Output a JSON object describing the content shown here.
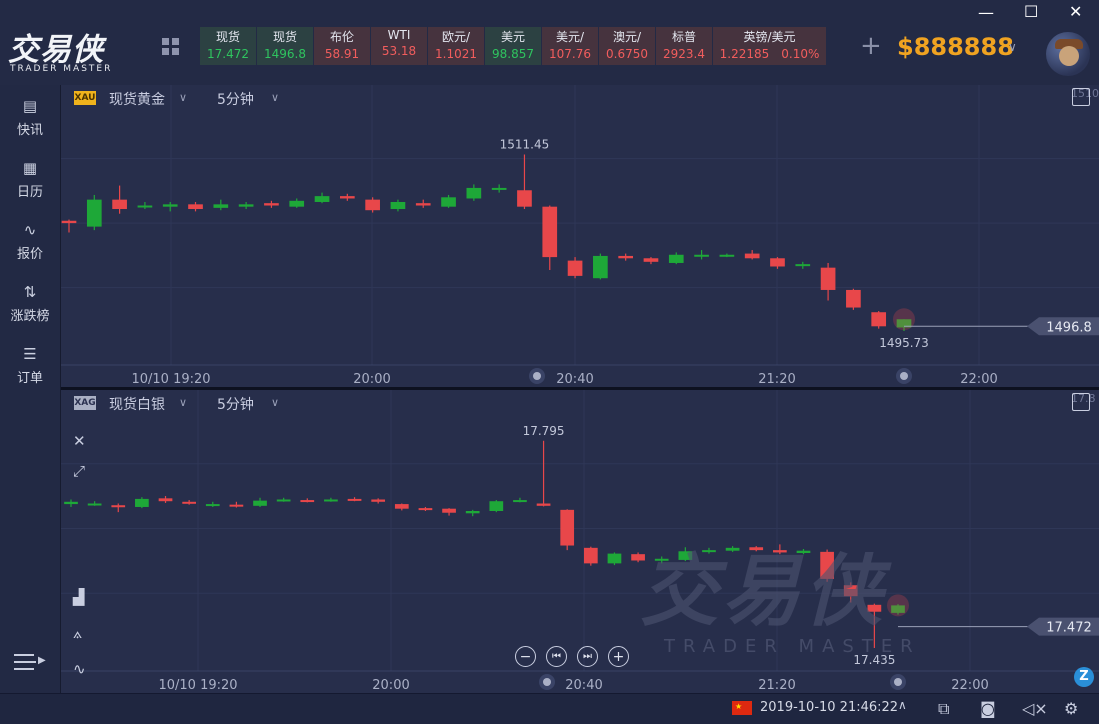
{
  "header": {
    "logo_cn": "交易侠",
    "logo_en": "TRADER MASTER",
    "balance": "$888888",
    "tickers": [
      {
        "name": "现货",
        "value": "17.472",
        "trend": "up"
      },
      {
        "name": "现货",
        "value": "1496.8",
        "trend": "up"
      },
      {
        "name": "布伦",
        "value": "58.91",
        "trend": "down"
      },
      {
        "name": "WTI",
        "value": "53.18",
        "trend": "down"
      },
      {
        "name": "欧元/",
        "value": "1.1021",
        "trend": "down"
      },
      {
        "name": "美元",
        "value": "98.857",
        "trend": "up"
      },
      {
        "name": "美元/",
        "value": "107.76",
        "trend": "down"
      },
      {
        "name": "澳元/",
        "value": "0.6750",
        "trend": "down"
      },
      {
        "name": "标普",
        "value": "2923.4",
        "trend": "down"
      },
      {
        "name": "英镑/美元",
        "value": "1.22185",
        "extra": "0.10%",
        "trend": "down"
      }
    ]
  },
  "sidebar": {
    "items": [
      {
        "label": "快讯",
        "icon": "newspaper-icon"
      },
      {
        "label": "日历",
        "icon": "calendar-icon"
      },
      {
        "label": "报价",
        "icon": "trend-line-icon"
      },
      {
        "label": "涨跌榜",
        "icon": "up-down-arrows-icon"
      },
      {
        "label": "订单",
        "icon": "order-list-icon"
      }
    ]
  },
  "charts": {
    "top": {
      "tag": "XAU",
      "name": "现货黄金",
      "period": "5分钟",
      "corner_label": "1510",
      "last_price": "1496.8"
    },
    "bottom": {
      "tag": "XAG",
      "name": "现货白银",
      "period": "5分钟",
      "corner_label": "17.8",
      "last_price": "17.472"
    }
  },
  "status": {
    "datetime": "2019-10-10 21:46:22"
  },
  "watermark": {
    "cn": "交易侠",
    "en": "TRADER MASTER"
  },
  "chart_data": [
    {
      "type": "candlestick",
      "title": "现货黄金",
      "period": "5分钟",
      "x_ticks": [
        "10/10 19:20",
        "20:00",
        "20:40",
        "21:20",
        "22:00"
      ],
      "high_label": "1511.45",
      "low_label": "1495.73",
      "last": "1496.8",
      "ylim": [
        1493.5,
        1515.5
      ],
      "candles": [
        {
          "o": 1505.8,
          "c": 1505.6,
          "h": 1505.9,
          "l": 1504.8
        },
        {
          "o": 1505.3,
          "c": 1507.6,
          "h": 1508.0,
          "l": 1505.0
        },
        {
          "o": 1507.6,
          "c": 1506.8,
          "h": 1508.8,
          "l": 1506.4
        },
        {
          "o": 1507.0,
          "c": 1507.1,
          "h": 1507.4,
          "l": 1506.8
        },
        {
          "o": 1507.0,
          "c": 1507.2,
          "h": 1507.4,
          "l": 1506.6
        },
        {
          "o": 1507.2,
          "c": 1506.8,
          "h": 1507.4,
          "l": 1506.6
        },
        {
          "o": 1506.9,
          "c": 1507.2,
          "h": 1507.6,
          "l": 1506.7
        },
        {
          "o": 1507.0,
          "c": 1507.2,
          "h": 1507.4,
          "l": 1506.8
        },
        {
          "o": 1507.3,
          "c": 1507.1,
          "h": 1507.5,
          "l": 1506.9
        },
        {
          "o": 1507.0,
          "c": 1507.5,
          "h": 1507.7,
          "l": 1506.9
        },
        {
          "o": 1507.4,
          "c": 1507.9,
          "h": 1508.2,
          "l": 1507.3
        },
        {
          "o": 1507.9,
          "c": 1507.7,
          "h": 1508.1,
          "l": 1507.5
        },
        {
          "o": 1507.6,
          "c": 1506.7,
          "h": 1507.8,
          "l": 1506.5
        },
        {
          "o": 1506.8,
          "c": 1507.4,
          "h": 1507.6,
          "l": 1506.6
        },
        {
          "o": 1507.3,
          "c": 1507.1,
          "h": 1507.6,
          "l": 1506.9
        },
        {
          "o": 1507.0,
          "c": 1507.8,
          "h": 1508.0,
          "l": 1506.9
        },
        {
          "o": 1507.7,
          "c": 1508.6,
          "h": 1508.9,
          "l": 1507.5
        },
        {
          "o": 1508.5,
          "c": 1508.6,
          "h": 1508.9,
          "l": 1508.2
        },
        {
          "o": 1508.4,
          "c": 1507.0,
          "h": 1511.45,
          "l": 1506.8
        },
        {
          "o": 1507.0,
          "c": 1502.7,
          "h": 1507.1,
          "l": 1501.6
        },
        {
          "o": 1502.4,
          "c": 1501.1,
          "h": 1502.7,
          "l": 1500.9
        },
        {
          "o": 1500.9,
          "c": 1502.8,
          "h": 1503.0,
          "l": 1500.8
        },
        {
          "o": 1502.8,
          "c": 1502.6,
          "h": 1503.0,
          "l": 1502.4
        },
        {
          "o": 1502.6,
          "c": 1502.3,
          "h": 1502.7,
          "l": 1502.1
        },
        {
          "o": 1502.2,
          "c": 1502.9,
          "h": 1503.1,
          "l": 1502.1
        },
        {
          "o": 1502.8,
          "c": 1502.9,
          "h": 1503.3,
          "l": 1502.5
        },
        {
          "o": 1502.9,
          "c": 1502.9,
          "h": 1503.0,
          "l": 1502.7
        },
        {
          "o": 1503.0,
          "c": 1502.6,
          "h": 1503.3,
          "l": 1502.5
        },
        {
          "o": 1502.6,
          "c": 1501.9,
          "h": 1502.7,
          "l": 1501.7
        },
        {
          "o": 1502.0,
          "c": 1502.1,
          "h": 1502.3,
          "l": 1501.7
        },
        {
          "o": 1501.8,
          "c": 1499.9,
          "h": 1502.2,
          "l": 1499.0
        },
        {
          "o": 1499.9,
          "c": 1498.4,
          "h": 1500.0,
          "l": 1498.2
        },
        {
          "o": 1498.0,
          "c": 1496.8,
          "h": 1498.1,
          "l": 1496.6
        },
        {
          "o": 1496.7,
          "c": 1497.4,
          "h": 1497.4,
          "l": 1496.4
        }
      ]
    },
    {
      "type": "candlestick",
      "title": "现货白银",
      "period": "5分钟",
      "x_ticks": [
        "10/10 19:20",
        "20:00",
        "20:40",
        "21:20",
        "22:00"
      ],
      "high_label": "17.795",
      "low_label": "17.435",
      "last": "17.472",
      "ylim": [
        17.395,
        17.845
      ],
      "candles": [
        {
          "o": 17.685,
          "c": 17.689,
          "h": 17.693,
          "l": 17.68
        },
        {
          "o": 17.686,
          "c": 17.686,
          "h": 17.69,
          "l": 17.682
        },
        {
          "o": 17.683,
          "c": 17.68,
          "h": 17.686,
          "l": 17.671
        },
        {
          "o": 17.68,
          "c": 17.694,
          "h": 17.697,
          "l": 17.678
        },
        {
          "o": 17.695,
          "c": 17.69,
          "h": 17.699,
          "l": 17.687
        },
        {
          "o": 17.689,
          "c": 17.686,
          "h": 17.692,
          "l": 17.684
        },
        {
          "o": 17.685,
          "c": 17.685,
          "h": 17.689,
          "l": 17.68
        },
        {
          "o": 17.684,
          "c": 17.682,
          "h": 17.689,
          "l": 17.679
        },
        {
          "o": 17.682,
          "c": 17.691,
          "h": 17.696,
          "l": 17.68
        },
        {
          "o": 17.692,
          "c": 17.693,
          "h": 17.696,
          "l": 17.689
        },
        {
          "o": 17.692,
          "c": 17.691,
          "h": 17.695,
          "l": 17.688
        },
        {
          "o": 17.691,
          "c": 17.693,
          "h": 17.696,
          "l": 17.689
        },
        {
          "o": 17.694,
          "c": 17.693,
          "h": 17.697,
          "l": 17.69
        },
        {
          "o": 17.693,
          "c": 17.689,
          "h": 17.695,
          "l": 17.686
        },
        {
          "o": 17.685,
          "c": 17.677,
          "h": 17.686,
          "l": 17.674
        },
        {
          "o": 17.678,
          "c": 17.676,
          "h": 17.68,
          "l": 17.673
        },
        {
          "o": 17.677,
          "c": 17.67,
          "h": 17.678,
          "l": 17.665
        },
        {
          "o": 17.669,
          "c": 17.673,
          "h": 17.675,
          "l": 17.664
        },
        {
          "o": 17.673,
          "c": 17.69,
          "h": 17.692,
          "l": 17.671
        },
        {
          "o": 17.69,
          "c": 17.692,
          "h": 17.696,
          "l": 17.688
        },
        {
          "o": 17.686,
          "c": 17.682,
          "h": 17.795,
          "l": 17.681
        },
        {
          "o": 17.675,
          "c": 17.613,
          "h": 17.676,
          "l": 17.605
        },
        {
          "o": 17.609,
          "c": 17.582,
          "h": 17.611,
          "l": 17.578
        },
        {
          "o": 17.582,
          "c": 17.599,
          "h": 17.601,
          "l": 17.579
        },
        {
          "o": 17.598,
          "c": 17.587,
          "h": 17.601,
          "l": 17.584
        },
        {
          "o": 17.587,
          "c": 17.59,
          "h": 17.594,
          "l": 17.582
        },
        {
          "o": 17.588,
          "c": 17.603,
          "h": 17.61,
          "l": 17.586
        },
        {
          "o": 17.603,
          "c": 17.605,
          "h": 17.609,
          "l": 17.599
        },
        {
          "o": 17.604,
          "c": 17.609,
          "h": 17.612,
          "l": 17.602
        },
        {
          "o": 17.61,
          "c": 17.605,
          "h": 17.612,
          "l": 17.603
        },
        {
          "o": 17.605,
          "c": 17.601,
          "h": 17.615,
          "l": 17.598
        },
        {
          "o": 17.6,
          "c": 17.604,
          "h": 17.607,
          "l": 17.598
        },
        {
          "o": 17.602,
          "c": 17.555,
          "h": 17.606,
          "l": 17.55
        },
        {
          "o": 17.544,
          "c": 17.525,
          "h": 17.549,
          "l": 17.514
        },
        {
          "o": 17.51,
          "c": 17.498,
          "h": 17.512,
          "l": 17.435
        },
        {
          "o": 17.496,
          "c": 17.509,
          "h": 17.511,
          "l": 17.493
        }
      ]
    }
  ]
}
